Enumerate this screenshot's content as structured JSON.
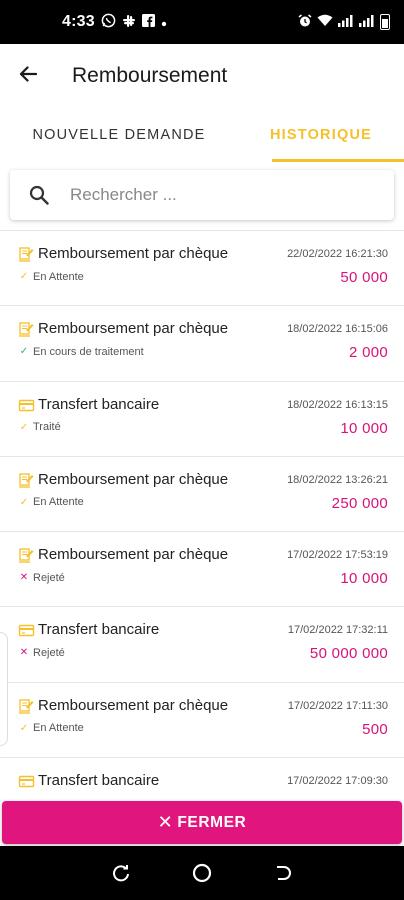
{
  "status_bar": {
    "time": "4:33",
    "left_icons": [
      "whatsapp-icon",
      "slack-icon",
      "facebook-icon",
      "dot-icon"
    ],
    "right_icons": [
      "alarm-icon",
      "wifi-icon",
      "signal-icon",
      "signal-icon",
      "battery-icon"
    ]
  },
  "header": {
    "title": "Remboursement",
    "back_icon": "arrow-left-icon"
  },
  "tabs": [
    {
      "label": "NOUVELLE DEMANDE",
      "active": false
    },
    {
      "label": "HISTORIQUE",
      "active": true
    }
  ],
  "search": {
    "placeholder": "Rechercher ...",
    "value": ""
  },
  "colors": {
    "accent_yellow": "#f5c02a",
    "amount_pink": "#d6137a",
    "button_pink": "#e0157e",
    "check_green": "#2bb673",
    "check_yellow": "#f5c02a",
    "reject_red": "#d6137a"
  },
  "transactions": [
    {
      "type": "Remboursement par chèque",
      "icon": "cheque-icon",
      "date": "22/02/2022 16:21:30",
      "status": "En Attente",
      "status_icon": "check-yellow",
      "amount": "50 000"
    },
    {
      "type": "Remboursement par chèque",
      "icon": "cheque-icon",
      "date": "18/02/2022 16:15:06",
      "status": "En cours de traitement",
      "status_icon": "check-green",
      "amount": "2 000"
    },
    {
      "type": "Transfert bancaire",
      "icon": "card-icon",
      "date": "18/02/2022 16:13:15",
      "status": "Traité",
      "status_icon": "check-yellow",
      "amount": "10 000"
    },
    {
      "type": "Remboursement par chèque",
      "icon": "cheque-icon",
      "date": "18/02/2022 13:26:21",
      "status": "En Attente",
      "status_icon": "check-yellow",
      "amount": "250 000"
    },
    {
      "type": "Remboursement par chèque",
      "icon": "cheque-icon",
      "date": "17/02/2022 17:53:19",
      "status": "Rejeté",
      "status_icon": "cross-red",
      "amount": "10 000"
    },
    {
      "type": "Transfert bancaire",
      "icon": "card-icon",
      "date": "17/02/2022 17:32:11",
      "status": "Rejeté",
      "status_icon": "cross-red",
      "amount": "50 000 000"
    },
    {
      "type": "Remboursement par chèque",
      "icon": "cheque-icon",
      "date": "17/02/2022 17:11:30",
      "status": "En Attente",
      "status_icon": "check-yellow",
      "amount": "500"
    },
    {
      "type": "Transfert bancaire",
      "icon": "card-icon",
      "date": "17/02/2022 17:09:30",
      "status": "",
      "status_icon": "",
      "amount": ""
    }
  ],
  "close_button": {
    "label": "FERMER",
    "icon": "close-icon"
  },
  "nav_bar": {
    "buttons": [
      "recents-icon",
      "home-icon",
      "back-icon"
    ]
  }
}
